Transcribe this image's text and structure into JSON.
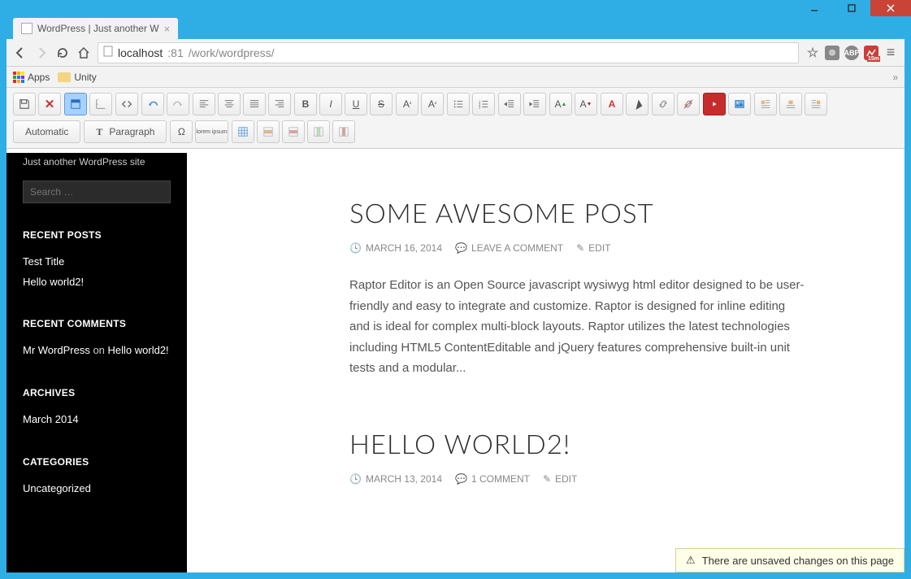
{
  "window": {
    "title": "WordPress | Just another W"
  },
  "browser": {
    "tab_title": "WordPress | Just another W",
    "url_host": "localhost",
    "url_port": ":81",
    "url_path": "/work/wordpress/",
    "bookmarks": {
      "apps": "Apps",
      "unity": "Unity"
    },
    "ext_badge": "15m"
  },
  "editor": {
    "mode": "Automatic",
    "format": "Paragraph",
    "lorem": "lorem ipsum",
    "omega": "Ω"
  },
  "sidebar": {
    "tagline": "Just another WordPress site",
    "search_placeholder": "Search …",
    "recent_posts_h": "RECENT POSTS",
    "recent_posts": [
      "Test Title",
      "Hello world2!"
    ],
    "recent_comments_h": "RECENT COMMENTS",
    "comment_author": "Mr WordPress",
    "comment_on": " on ",
    "comment_post": "Hello world2!",
    "archives_h": "ARCHIVES",
    "archives": [
      "March 2014"
    ],
    "categories_h": "CATEGORIES",
    "categories": [
      "Uncategorized"
    ]
  },
  "posts": [
    {
      "title": "SOME AWESOME POST",
      "date": "MARCH 16, 2014",
      "comments": "LEAVE A COMMENT",
      "edit": "EDIT",
      "body": "Raptor Editor is an Open Source javascript wysiwyg html editor designed to be user-friendly and easy to integrate and customize. Raptor is designed for inline editing and is ideal for complex multi-block layouts. Raptor utilizes the latest technologies including HTML5 ContentEditable and jQuery features comprehensive built-in unit tests and a modular..."
    },
    {
      "title": "HELLO WORLD2!",
      "date": "MARCH 13, 2014",
      "comments": "1 COMMENT",
      "edit": "EDIT",
      "body": ""
    }
  ],
  "notification": "There are unsaved changes on this page"
}
